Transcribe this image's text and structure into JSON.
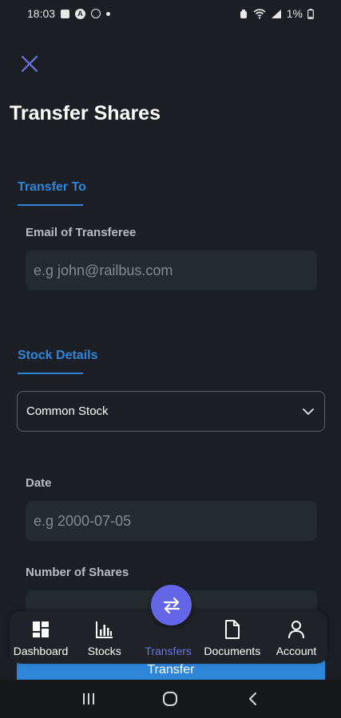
{
  "status_bar": {
    "time": "18:03",
    "battery": "1%"
  },
  "page": {
    "title": "Transfer Shares"
  },
  "transfer_to": {
    "section_title": "Transfer To",
    "email_label": "Email of Transferee",
    "email_placeholder": "e.g john@railbus.com"
  },
  "stock_details": {
    "section_title": "Stock Details",
    "stock_type_selected": "Common Stock",
    "date_label": "Date",
    "date_placeholder": "e.g 2000-07-05",
    "shares_label": "Number of Shares"
  },
  "actions": {
    "transfer_label": "Transfer"
  },
  "bottom_nav": {
    "items": [
      {
        "label": "Dashboard",
        "icon": "dashboard-icon"
      },
      {
        "label": "Stocks",
        "icon": "bar-chart-icon"
      },
      {
        "label": "Transfers",
        "icon": "transfer-arrows-icon"
      },
      {
        "label": "Documents",
        "icon": "document-icon"
      },
      {
        "label": "Account",
        "icon": "person-icon"
      }
    ],
    "active": "Transfers"
  },
  "colors": {
    "background": "#1c1f25",
    "accent_blue": "#2f86d9",
    "accent_purple": "#6366e6",
    "input_bg": "#262a31"
  }
}
